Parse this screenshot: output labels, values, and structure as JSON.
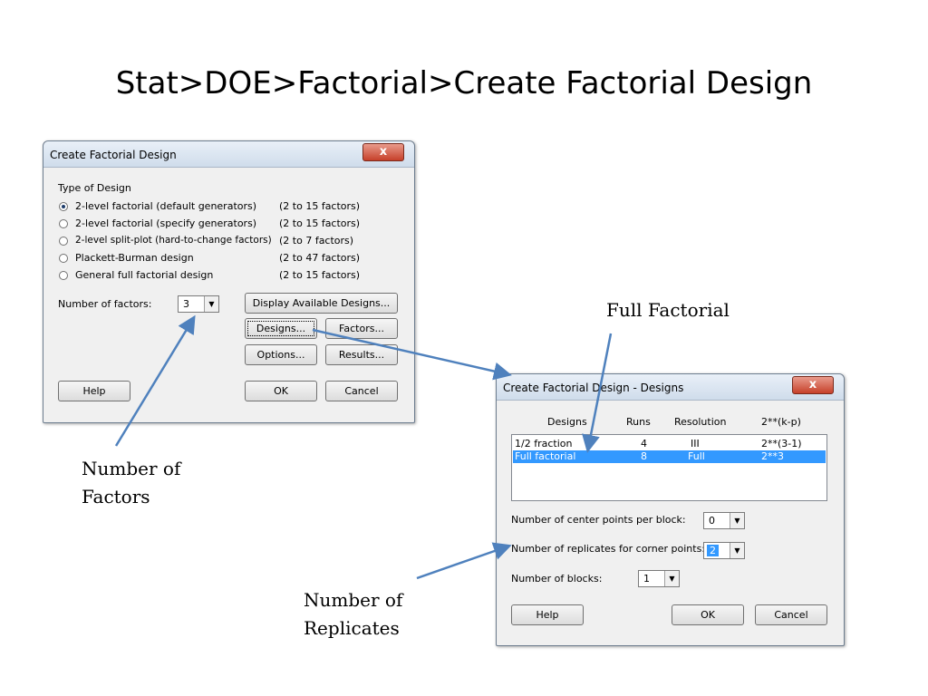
{
  "slide": {
    "title": "Stat>DOE>Factorial>Create Factorial Design"
  },
  "dialog1": {
    "title": "Create Factorial Design",
    "close_glyph": "x",
    "type_of_design_label": "Type of Design",
    "options": [
      {
        "label": "2-level factorial (default generators)",
        "range": "(2 to 15 factors)",
        "checked": true
      },
      {
        "label": "2-level factorial (specify generators)",
        "range": "(2 to 15 factors)",
        "checked": false
      },
      {
        "label": "2-level split-plot (hard-to-change factors)",
        "range": "(2 to 7 factors)",
        "checked": false
      },
      {
        "label": "Plackett-Burman design",
        "range": "(2 to 47 factors)",
        "checked": false
      },
      {
        "label": "General full factorial design",
        "range": "(2 to 15 factors)",
        "checked": false
      }
    ],
    "num_factors_label": "Number of factors:",
    "num_factors_value": "3",
    "buttons": {
      "display": "Display Available Designs...",
      "designs": "Designs...",
      "factors": "Factors...",
      "options": "Options...",
      "results": "Results...",
      "help": "Help",
      "ok": "OK",
      "cancel": "Cancel"
    }
  },
  "dialog2": {
    "title": "Create Factorial Design - Designs",
    "close_glyph": "x",
    "columns": [
      "Designs",
      "Runs",
      "Resolution",
      "2**(k-p)"
    ],
    "rows": [
      {
        "design": "1/2 fraction",
        "runs": "4",
        "resolution": "III",
        "formula": "2**(3-1)",
        "selected": false
      },
      {
        "design": "Full factorial",
        "runs": "8",
        "resolution": "Full",
        "formula": "2**3",
        "selected": true
      }
    ],
    "center_points_label": "Number of center points per block:",
    "center_points_value": "0",
    "replicates_label": "Number of replicates for corner points:",
    "replicates_value": "2",
    "blocks_label": "Number of blocks:",
    "blocks_value": "1",
    "buttons": {
      "help": "Help",
      "ok": "OK",
      "cancel": "Cancel"
    }
  },
  "annotations": {
    "full_factorial": "Full Factorial",
    "number_of_factors_line1": "Number of",
    "number_of_factors_line2": "Factors",
    "number_of_replicates_line1": "Number of",
    "number_of_replicates_line2": "Replicates"
  },
  "colors": {
    "arrow": "#4f81bd",
    "selection": "#3399ff",
    "close_button": "#c6402a"
  }
}
